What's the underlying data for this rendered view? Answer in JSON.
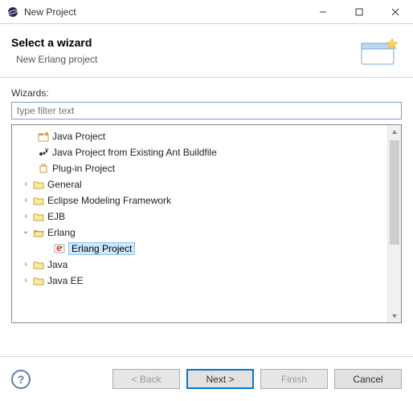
{
  "window": {
    "title": "New Project"
  },
  "header": {
    "title": "Select a wizard",
    "subtitle": "New Erlang project"
  },
  "wizards": {
    "label": "Wizards:",
    "filter_placeholder": "type filter text",
    "items": [
      {
        "label": "Java Project",
        "kind": "leaf",
        "icon": "java-proj"
      },
      {
        "label": "Java Project from Existing Ant Buildfile",
        "kind": "leaf",
        "icon": "ant-proj"
      },
      {
        "label": "Plug-in Project",
        "kind": "leaf",
        "icon": "plugin-proj"
      },
      {
        "label": "General",
        "kind": "folder",
        "expanded": false
      },
      {
        "label": "Eclipse Modeling Framework",
        "kind": "folder",
        "expanded": false
      },
      {
        "label": "EJB",
        "kind": "folder",
        "expanded": false
      },
      {
        "label": "Erlang",
        "kind": "folder",
        "expanded": true,
        "children": [
          {
            "label": "Erlang Project",
            "kind": "leaf",
            "icon": "erlang-proj",
            "selected": true
          }
        ]
      },
      {
        "label": "Java",
        "kind": "folder",
        "expanded": false
      },
      {
        "label": "Java EE",
        "kind": "folder",
        "expanded": false
      }
    ]
  },
  "buttons": {
    "back": "< Back",
    "next": "Next >",
    "finish": "Finish",
    "cancel": "Cancel"
  }
}
